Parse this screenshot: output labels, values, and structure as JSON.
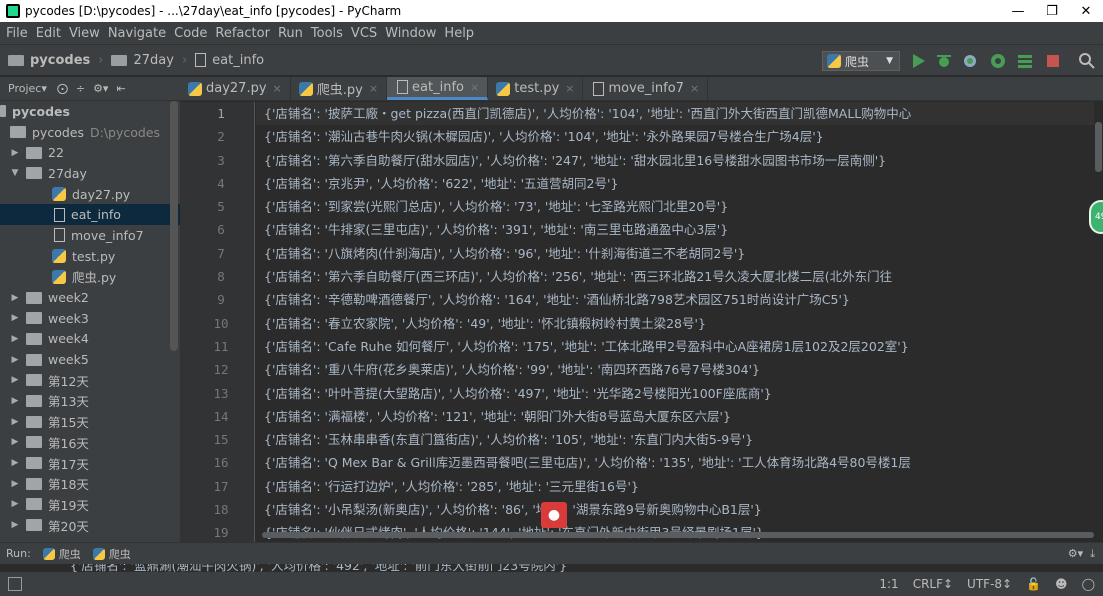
{
  "window": {
    "title": "pycodes [D:\\pycodes] - ...\\27day\\eat_info [pycodes] - PyCharm"
  },
  "menu": [
    "File",
    "Edit",
    "View",
    "Navigate",
    "Code",
    "Refactor",
    "Run",
    "Tools",
    "VCS",
    "Window",
    "Help"
  ],
  "breadcrumb": [
    "pycodes",
    "27day",
    "eat_info"
  ],
  "run_config": "爬虫",
  "sidebar": {
    "header": "Projec▾",
    "tree": [
      {
        "label": "pycodes",
        "indent": 0,
        "type": "root"
      },
      {
        "label": "pycodes",
        "path": "D:\\pycodes",
        "indent": 0,
        "type": "folder"
      },
      {
        "label": "22",
        "indent": 1,
        "type": "folder",
        "arrow": "▶"
      },
      {
        "label": "27day",
        "indent": 1,
        "type": "folder",
        "arrow": "▼"
      },
      {
        "label": "day27.py",
        "indent": 2,
        "type": "py"
      },
      {
        "label": "eat_info",
        "indent": 2,
        "type": "txt",
        "selected": true
      },
      {
        "label": "move_info7",
        "indent": 2,
        "type": "txt"
      },
      {
        "label": "test.py",
        "indent": 2,
        "type": "py"
      },
      {
        "label": "爬虫.py",
        "indent": 2,
        "type": "py"
      },
      {
        "label": "week2",
        "indent": 1,
        "type": "folder",
        "arrow": "▶"
      },
      {
        "label": "week3",
        "indent": 1,
        "type": "folder",
        "arrow": "▶"
      },
      {
        "label": "week4",
        "indent": 1,
        "type": "folder",
        "arrow": "▶"
      },
      {
        "label": "week5",
        "indent": 1,
        "type": "folder",
        "arrow": "▶"
      },
      {
        "label": "第12天",
        "indent": 1,
        "type": "folder",
        "arrow": "▶"
      },
      {
        "label": "第13天",
        "indent": 1,
        "type": "folder",
        "arrow": "▶"
      },
      {
        "label": "第15天",
        "indent": 1,
        "type": "folder",
        "arrow": "▶"
      },
      {
        "label": "第16天",
        "indent": 1,
        "type": "folder",
        "arrow": "▶"
      },
      {
        "label": "第17天",
        "indent": 1,
        "type": "folder",
        "arrow": "▶"
      },
      {
        "label": "第18天",
        "indent": 1,
        "type": "folder",
        "arrow": "▶"
      },
      {
        "label": "第19天",
        "indent": 1,
        "type": "folder",
        "arrow": "▶"
      },
      {
        "label": "第20天",
        "indent": 1,
        "type": "folder",
        "arrow": "▶"
      }
    ]
  },
  "tabs": [
    {
      "label": "day27.py",
      "type": "py"
    },
    {
      "label": "爬虫.py",
      "type": "py"
    },
    {
      "label": "eat_info",
      "type": "txt",
      "active": true
    },
    {
      "label": "test.py",
      "type": "py"
    },
    {
      "label": "move_info7",
      "type": "txt"
    }
  ],
  "editor": {
    "lines": [
      "{'店铺名': '披萨工廠・get pizza(西直门凯德店)', '人均价格': '104', '地址': '西直门外大街西直门凯德MALL购物中心",
      "{'店铺名': '潮汕古巷牛肉火锅(木樨园店)', '人均价格': '104', '地址': '永外路果园7号楼合生广场4层'}",
      "{'店铺名': '第六季自助餐厅(甜水园店)', '人均价格': '247', '地址': '甜水园北里16号楼甜水园图书市场一层南侧'}",
      "{'店铺名': '京兆尹', '人均价格': '622', '地址': '五道营胡同2号'}",
      "{'店铺名': '到家尝(光熙门总店)', '人均价格': '73', '地址': '七圣路光熙门北里20号'}",
      "{'店铺名': '牛排家(三里屯店)', '人均价格': '391', '地址': '南三里屯路通盈中心3层'}",
      "{'店铺名': '八旗烤肉(什刹海店)', '人均价格': '96', '地址': '什刹海街道三不老胡同2号'}",
      "{'店铺名': '第六季自助餐厅(西三环店)', '人均价格': '256', '地址': '西三环北路21号久凌大厦北楼二层(北外东门往",
      "{'店铺名': '辛德勒啤酒德餐厅', '人均价格': '164', '地址': '酒仙桥北路798艺术园区751时尚设计广场C5'}",
      "{'店铺名': '春立农家院', '人均价格': '49', '地址': '怀北镇椴树岭村黄土梁28号'}",
      "{'店铺名': 'Cafe Ruhe 如何餐厅', '人均价格': '175', '地址': '工体北路甲2号盈科中心A座裙房1层102及2层202室'}",
      "{'店铺名': '重八牛府(花乡奥莱店)', '人均价格': '99', '地址': '南四环西路76号7号楼304'}",
      "{'店铺名': '叶叶菩提(大望路店)', '人均价格': '497', '地址': '光华路2号楼阳光100F座底商'}",
      "{'店铺名': '满福楼', '人均价格': '121', '地址': '朝阳门外大街8号蓝岛大厦东区六层'}",
      "{'店铺名': '玉林串串香(东直门簋街店)', '人均价格': '105', '地址': '东直门内大街5-9号'}",
      "{'店铺名': 'Q Mex Bar & Grill库迈墨西哥餐吧(三里屯店)', '人均价格': '135', '地址': '工人体育场北路4号80号楼1层",
      "{'店铺名': '行运打边炉', '人均价格': '285', '地址': '三元里街16号'}",
      "{'店铺名': '小吊梨汤(新奥店)', '人均价格': '86', '地址': '湖景东路9号新奥购物中心B1层'}",
      "{'店铺名': '伙伴日式烤肉', '人均价格': '144', '地址': '东直门外新中街甲3号绎景剧场1层'}"
    ]
  },
  "run": {
    "label": "Run:",
    "tabs": [
      "爬虫",
      "爬虫"
    ]
  },
  "console_line": "{'店铺名': '蓝鼎涮(潮汕牛肉火锅)', '人均价格': '492', '地址': '前门东大街前门23号院内'}",
  "status": {
    "position": "1:1",
    "line_sep": "CRLF↕",
    "encoding": "UTF-8↕"
  },
  "colors": {
    "accent": "#4a88c7",
    "bg": "#2b2b2b",
    "panel": "#3c3f41"
  }
}
